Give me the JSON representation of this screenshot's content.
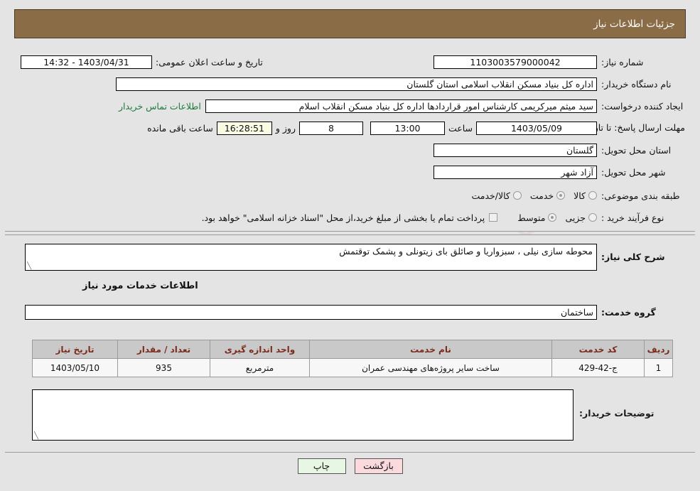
{
  "header": {
    "title": "جزئیات اطلاعات نیاز"
  },
  "form": {
    "need_number_label": "شماره نیاز:",
    "need_number_value": "1103003579000042",
    "announce_datetime_label": "تاریخ و ساعت اعلان عمومی:",
    "announce_datetime_value": "1403/04/31 - 14:32",
    "buyer_org_label": "نام دستگاه خریدار:",
    "buyer_org_value": "اداره کل بنیاد مسکن انقلاب اسلامی استان گلستان",
    "creator_label": "ایجاد کننده درخواست:",
    "creator_value": "سید میثم میرکریمی کارشناس امور قراردادها اداره کل بنیاد مسکن انقلاب اسلام",
    "buyer_contact_link": "اطلاعات تماس خریدار",
    "deadline_label": "مهلت ارسال پاسخ: تا تاریخ:",
    "deadline_date": "1403/05/09",
    "hour_label": "ساعت",
    "deadline_time": "13:00",
    "days_remaining": "8",
    "days_label": "روز و",
    "countdown": "16:28:51",
    "remaining_label": "ساعت باقی مانده",
    "province_label": "استان محل تحویل:",
    "province_value": "گلستان",
    "city_label": "شهر محل تحویل:",
    "city_value": "آزاد شهر",
    "category_label": "طبقه بندی موضوعی:",
    "category_options": [
      {
        "label": "کالا",
        "selected": false
      },
      {
        "label": "خدمت",
        "selected": true
      },
      {
        "label": "کالا/خدمت",
        "selected": false
      }
    ],
    "process_label": "نوع فرآیند خرید :",
    "process_options": [
      {
        "label": "جزیی",
        "selected": false
      },
      {
        "label": "متوسط",
        "selected": true
      }
    ],
    "treasury_note": "پرداخت تمام یا بخشی از مبلغ خرید،از محل \"اسناد خزانه اسلامی\" خواهد بود."
  },
  "description": {
    "general_need_label": "شرح کلی نیاز:",
    "general_need_value": "محوطه سازی نیلی ، سبزواریا و صائلق بای زیتونلی و پشمک توقتمش",
    "services_section_title": "اطلاعات خدمات مورد نیاز",
    "service_group_label": "گروه خدمت:",
    "service_group_value": "ساختمان"
  },
  "table": {
    "columns": [
      "ردیف",
      "کد خدمت",
      "نام خدمت",
      "واحد اندازه گیری",
      "تعداد / مقدار",
      "تاریخ نیاز"
    ],
    "rows": [
      {
        "index": "1",
        "code": "ج-42-429",
        "name": "ساخت سایر پروژه‌های مهندسی عمران",
        "unit": "مترمربع",
        "quantity": "935",
        "need_date": "1403/05/10"
      }
    ]
  },
  "buyer_notes": {
    "label": "توضیحات خریدار:",
    "value": ""
  },
  "footer": {
    "back_button": "بازگشت",
    "print_button": "چاپ"
  },
  "watermark": {
    "text": "AriaTender.net"
  }
}
